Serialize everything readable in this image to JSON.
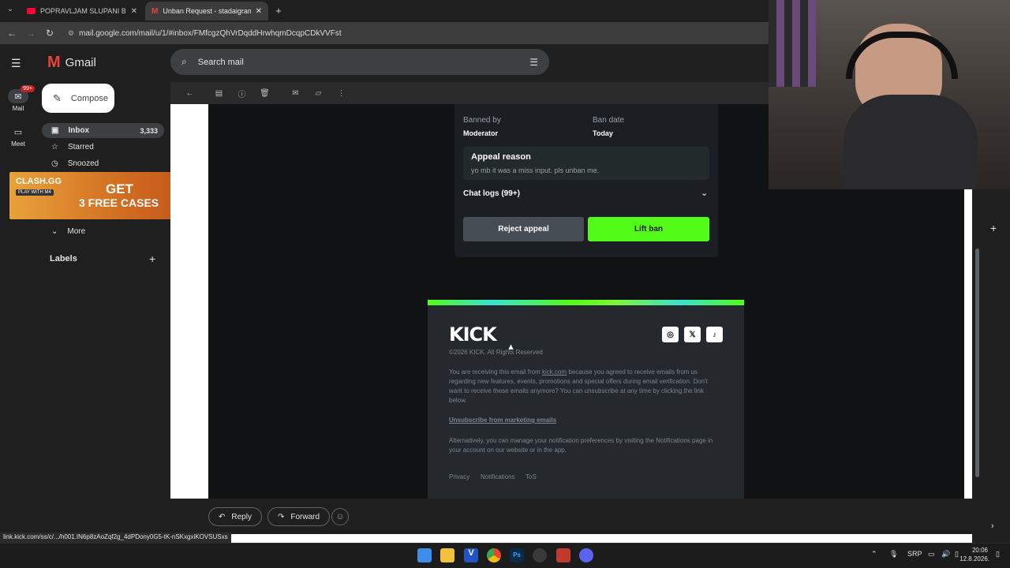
{
  "browser": {
    "tabs": [
      {
        "title": "POPRAVLJAM SLUPANI BMW M...",
        "icon": "youtube-icon",
        "active": false
      },
      {
        "title": "Unban Request - stadaigram@...",
        "icon": "gmail-icon",
        "active": true
      }
    ],
    "url": "mail.google.com/mail/u/1/#inbox/FMfcgzQhVrDqddHrwhqmDcqpCDkVVFst"
  },
  "gmail": {
    "brand": "Gmail",
    "rail": [
      {
        "label": "Mail",
        "badge": "99+"
      },
      {
        "label": "Meet"
      }
    ],
    "compose_label": "Compose",
    "nav": [
      {
        "label": "Inbox",
        "count": "3,333",
        "active": true
      },
      {
        "label": "Starred"
      },
      {
        "label": "Snoozed"
      },
      {
        "label": "More"
      }
    ],
    "labels_heading": "Labels",
    "search_placeholder": "Search mail"
  },
  "ad": {
    "brand": "CLASH.GG",
    "sub": "PLAY WITH M4",
    "line1": "GET",
    "line2": "3 FREE CASES"
  },
  "email": {
    "banned_by_label": "Banned by",
    "banned_by_value": "Moderator",
    "ban_date_label": "Ban date",
    "ban_date_value": "Today",
    "appeal_title": "Appeal reason",
    "appeal_text": "yo mb it was a miss input. pls unban me.",
    "chat_logs": "Chat logs (99+)",
    "reject_label": "Reject appeal",
    "lift_label": "Lift ban",
    "footer": {
      "logo": "KICK",
      "copyright": "©2026 KICK. All Rights Reserved",
      "notice_prefix": "You are receiving this email from ",
      "notice_link": "kick.com",
      "notice_suffix": " because you agreed to receive emails from us regarding new features, events, promotions and special offers during email verification. Don't want to receive these emails anymore? You can unsubscribe at any time by clicking the link below.",
      "unsubscribe": "Unsubscribe from marketing emails",
      "alt_text": "Alternatively, you can manage your notification preferences by visiting the Notifications page in your account on our website or in the app.",
      "links": [
        "Privacy",
        "Notifications",
        "ToS"
      ]
    }
  },
  "reply": {
    "reply_label": "Reply",
    "forward_label": "Forward"
  },
  "status_url": "link.kick.com/ss/c/.../h001.IN6p8zAoZqf2g_4dPDony0G5-tK-nSKxgxiKOVSUSxs",
  "taskbar": {
    "lang": "SRP",
    "time": "20:06",
    "date": "12.8.2026."
  },
  "colors": {
    "kick_green": "#53fc18",
    "reject_bg": "#474d55"
  }
}
